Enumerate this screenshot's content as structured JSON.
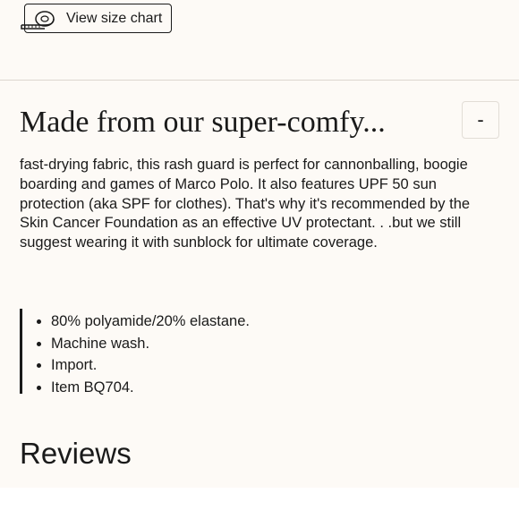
{
  "size_chart": {
    "label": "View size chart",
    "icon": "tape-measure-icon"
  },
  "accordion": {
    "title": "Made from our super-comfy...",
    "toggle_label": "-",
    "description": "fast-drying fabric, this rash guard is perfect for cannonballing, boogie boarding and games of Marco Polo. It also features UPF 50 sun protection (aka SPF for clothes). That's why it's recommended by the Skin Cancer Foundation as an effective UV protectant. . .but we still suggest wearing it with sunblock for ultimate coverage.",
    "features": [
      "80% polyamide/20% elastane.",
      "Machine wash.",
      "Import.",
      "Item BQ704."
    ]
  },
  "reviews": {
    "heading": "Reviews"
  },
  "colors": {
    "background": "#fdfaf6",
    "text": "#1a1a1a",
    "divider": "#dcd6cf"
  }
}
